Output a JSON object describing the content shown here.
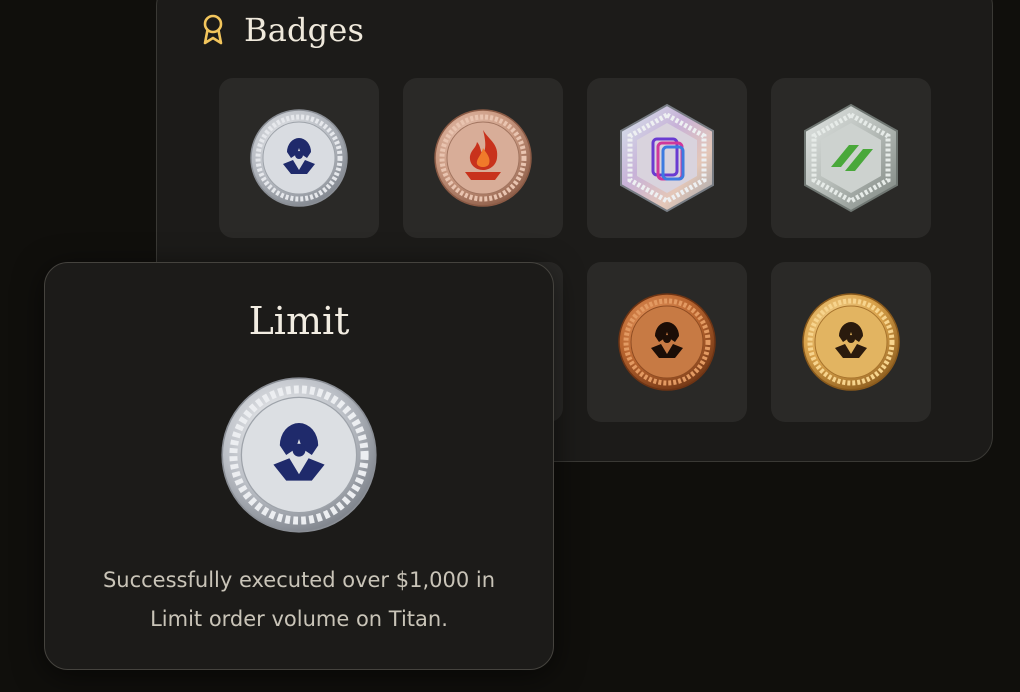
{
  "header": {
    "title": "Badges",
    "icon": "ribbon-award-icon",
    "icon_color": "#f2c55c"
  },
  "badges": [
    {
      "id": "limit-silver",
      "icon": "titan-emblem-icon",
      "shape": "round",
      "metal": "silver"
    },
    {
      "id": "fire-copper",
      "icon": "flame-icon",
      "shape": "round",
      "metal": "copper"
    },
    {
      "id": "holo-hex",
      "icon": "layered-squares-icon",
      "shape": "hexagon",
      "metal": "holographic"
    },
    {
      "id": "green-hex",
      "icon": "green-stripes-icon",
      "shape": "hexagon",
      "metal": "steel"
    },
    {
      "id": "titan-bronze",
      "icon": "titan-emblem-icon",
      "shape": "round",
      "metal": "bronze"
    },
    {
      "id": "titan-gold",
      "icon": "titan-emblem-icon",
      "shape": "round",
      "metal": "gold"
    }
  ],
  "popup": {
    "title": "Limit",
    "badge_icon": "titan-emblem-icon",
    "description": "Successfully executed over $1,000 in Limit order volume on Titan."
  },
  "colors": {
    "background": "#100f0c",
    "panel": "#1c1b19",
    "tile": "#2a2927",
    "accent": "#f2c55c"
  }
}
